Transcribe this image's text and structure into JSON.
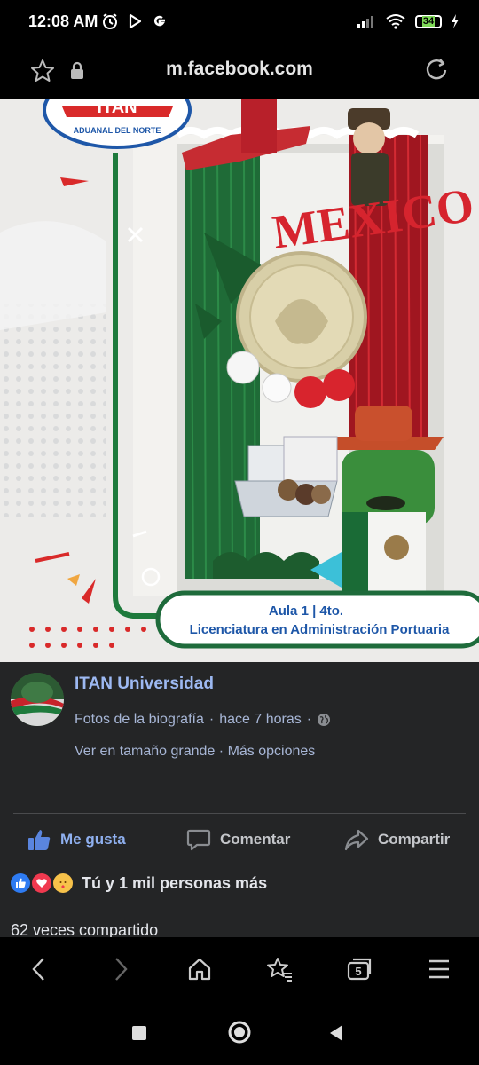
{
  "status_bar": {
    "time": "12:08 AM",
    "battery": "34"
  },
  "browser": {
    "url": "m.facebook.com",
    "icons": [
      "star-icon",
      "lock-icon",
      "reload-icon"
    ]
  },
  "photo": {
    "logo_text": "ITAN",
    "logo_subtext": "ADUANAL DEL NORTE",
    "mexico_text": "MEXICO",
    "banner_line1": "Aula 1 | 4to.",
    "banner_line2": "Licenciatura en Administración Portuaria"
  },
  "post": {
    "author": "ITAN Universidad",
    "meta_album": "Fotos de la biografía",
    "meta_sep": " · ",
    "meta_time": "hace 7 horas",
    "meta_sep2": " · ",
    "view_large": "Ver en tamaño grande",
    "links_sep": " · ",
    "more_options": "Más opciones",
    "actions": {
      "like": "Me gusta",
      "comment": "Comentar",
      "share": "Compartir"
    },
    "reactions_text": "Tú y 1 mil personas más",
    "shares_text": "62 veces compartido"
  },
  "bottom_nav": {
    "tab_count": "5"
  },
  "colors": {
    "link": "#9db9f2",
    "like_active": "#8fb0ef",
    "post_bg": "#242526",
    "banner_green": "#1e6b3b"
  }
}
